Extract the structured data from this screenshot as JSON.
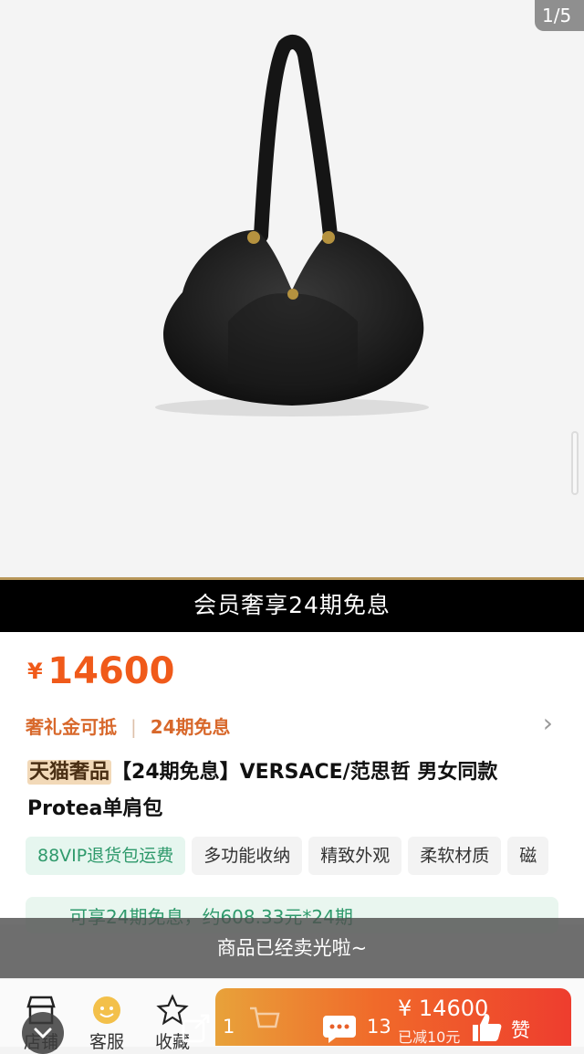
{
  "gallery": {
    "counter": "1/5"
  },
  "promo_banner": "会员奢享24期免息",
  "price": {
    "symbol": "¥",
    "amount": "14600"
  },
  "promotions": {
    "gift": "奢礼金可抵",
    "installment": "24期免息"
  },
  "product": {
    "badge": "天猫奢品",
    "title": "【24期免息】VERSACE/范思哲 男女同款 Protea单肩包"
  },
  "tags": [
    "88VIP退货包运费",
    "多功能收纳",
    "精致外观",
    "柔软材质",
    "磁"
  ],
  "installment_bar": "可享24期免息，约608.33元*24期",
  "sold_out_toast": "商品已经卖光啦~",
  "bottom_nav": {
    "store": "店铺",
    "service": "客服",
    "favorite": "收藏"
  },
  "buy": {
    "price": "¥ 14600",
    "sub": "已减10元"
  },
  "social": {
    "share_count": "1",
    "comment_count": "13",
    "like_label": "赞"
  },
  "colors": {
    "price": "#f05a1a",
    "tag_green": "#2f9a6c",
    "banner_gold": "#b8975a"
  }
}
